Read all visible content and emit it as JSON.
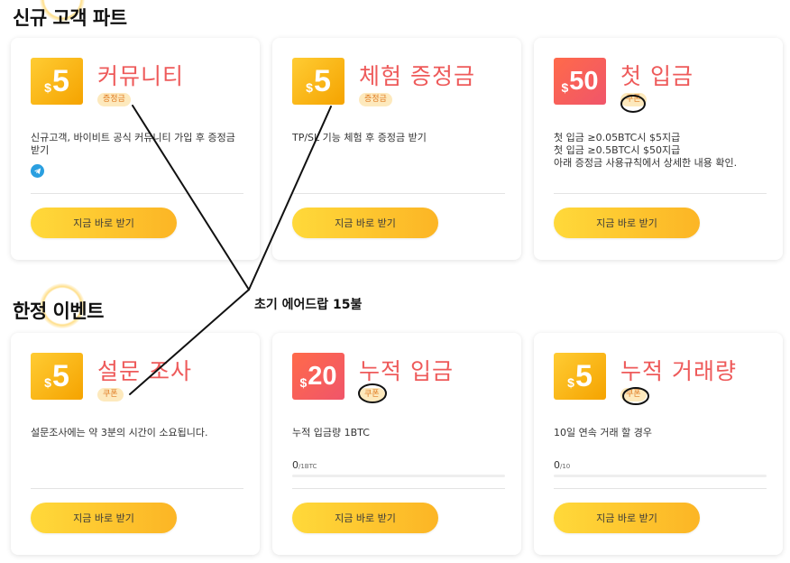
{
  "sections": {
    "new_customer": {
      "title": "신규 고객 파트"
    },
    "limited_event": {
      "title": "한정 이벤트"
    }
  },
  "cards": [
    {
      "amount_currency": "$",
      "amount": "5",
      "badge_color": "#f5a300",
      "title": "커뮤니티",
      "tag": "증정금",
      "desc": "신규고객, 바이비트 공식 커뮤니티 가입 후 증정금 받기",
      "icon": "telegram-icon",
      "button": "지금 바로 받기"
    },
    {
      "amount_currency": "$",
      "amount": "5",
      "badge_color": "#f5a300",
      "title": "체험 증정금",
      "tag": "증정금",
      "desc": "TP/SL 기능 체험 후 증정금 받기",
      "button": "지금 바로 받기"
    },
    {
      "amount_currency": "$",
      "amount": "50",
      "badge_color": "#f0556a",
      "title": "첫 입금",
      "tag": "쿠폰",
      "desc_lines": [
        "첫 입금 ≥0.05BTC시 $5지급",
        "첫 입금 ≥0.5BTC시 $50지급",
        "아래 증정금 사용규칙에서 상세한 내용 확인."
      ],
      "button": "지금 바로 받기"
    },
    {
      "amount_currency": "$",
      "amount": "5",
      "badge_color": "#f5a300",
      "title": "설문 조사",
      "tag": "쿠폰",
      "desc": "설문조사에는 약 3분의 시간이 소요됩니다.",
      "button": "지금 바로 받기"
    },
    {
      "amount_currency": "$",
      "amount": "20",
      "badge_color": "#f0556a",
      "title": "누적 입금",
      "tag": "쿠폰",
      "desc": "누적 입금량 1BTC",
      "progress_value": "0",
      "progress_unit": "/1BTC",
      "progress_fraction": 0,
      "button": "지금 바로 받기"
    },
    {
      "amount_currency": "$",
      "amount": "5",
      "badge_color": "#f5a300",
      "title": "누적 거래량",
      "tag": "쿠폰",
      "desc": "10일 연속 거래 할 경우",
      "progress_value": "0",
      "progress_unit": "/10",
      "progress_fraction": 0,
      "button": "지금 바로 받기"
    }
  ],
  "annotation": {
    "text": "초기 에어드랍 15불"
  }
}
